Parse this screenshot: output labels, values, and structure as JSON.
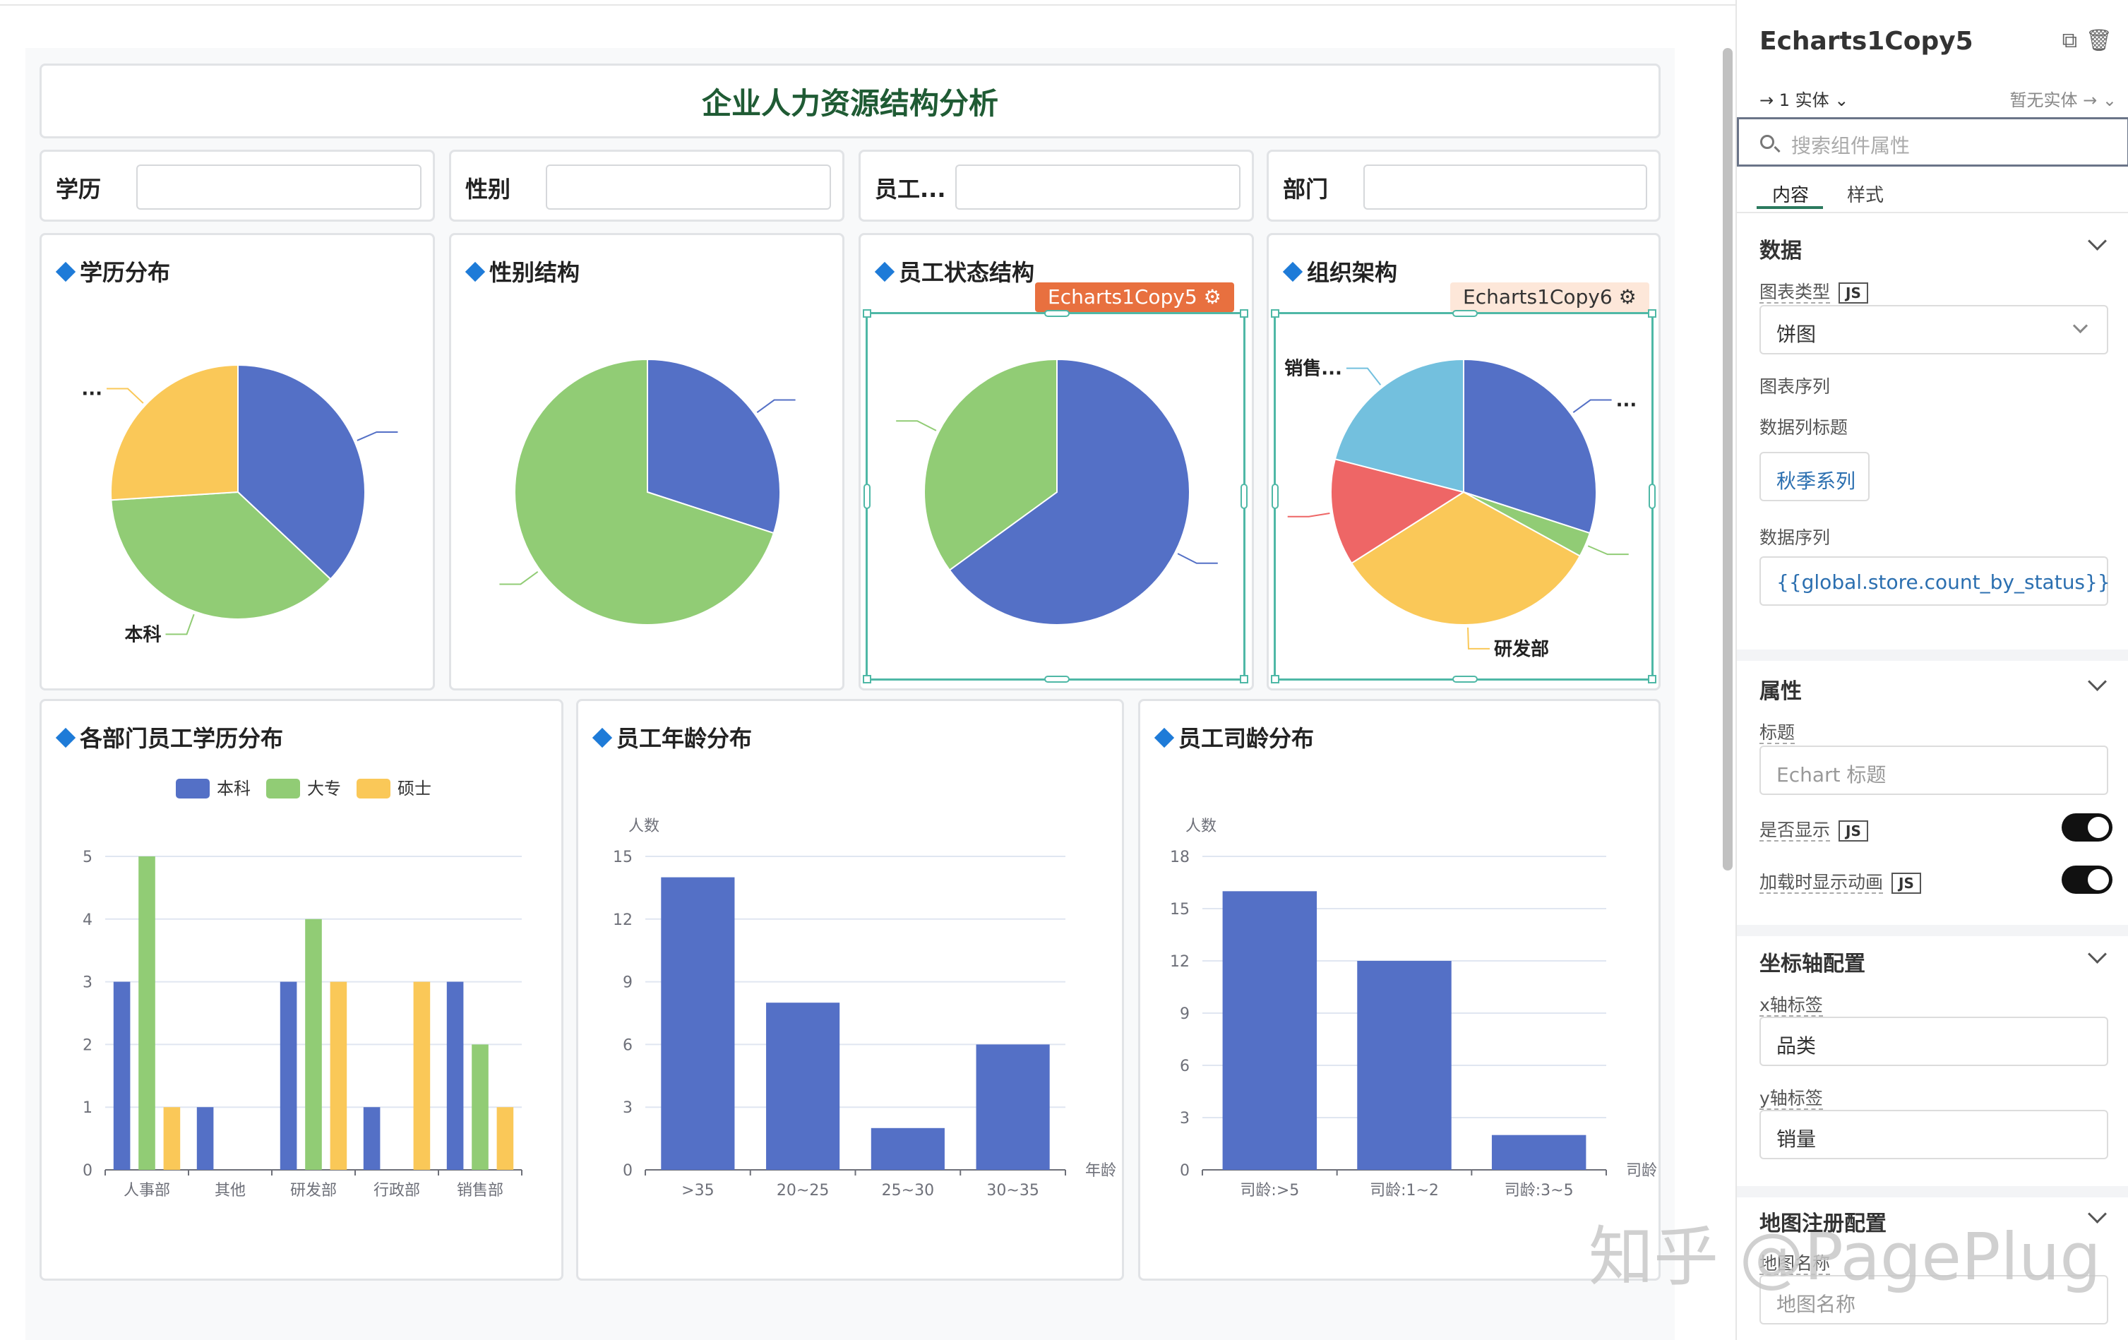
{
  "dashboard": {
    "title": "企业人力资源结构分析",
    "filters": [
      {
        "label": "学历",
        "value": ""
      },
      {
        "label": "性别",
        "value": ""
      },
      {
        "label": "员工...",
        "value": ""
      },
      {
        "label": "部门",
        "value": ""
      }
    ],
    "cards": {
      "edu": "学历分布",
      "gender": "性别结构",
      "status": "员工状态结构",
      "org": "组织架构",
      "dept_edu": "各部门员工学历分布",
      "age": "员工年龄分布",
      "tenure": "员工司龄分布"
    },
    "badges": {
      "status": "Echarts1Copy5",
      "org": "Echarts1Copy6"
    }
  },
  "chart_data": [
    {
      "type": "pie",
      "title": "学历分布",
      "slices": [
        {
          "name": "",
          "value": 37,
          "color": "#5470c6"
        },
        {
          "name": "本科",
          "value": 37,
          "color": "#91cc75"
        },
        {
          "name": "...",
          "value": 26,
          "color": "#fac858"
        }
      ],
      "visible_labels": [
        "...",
        "本科"
      ]
    },
    {
      "type": "pie",
      "title": "性别结构",
      "slices": [
        {
          "name": "",
          "value": 30,
          "color": "#5470c6"
        },
        {
          "name": "",
          "value": 70,
          "color": "#91cc75"
        }
      ]
    },
    {
      "type": "pie",
      "title": "员工状态结构",
      "slices": [
        {
          "name": "",
          "value": 65,
          "color": "#5470c6"
        },
        {
          "name": "",
          "value": 35,
          "color": "#91cc75"
        }
      ]
    },
    {
      "type": "pie",
      "title": "组织架构",
      "slices": [
        {
          "name": "...",
          "value": 30,
          "color": "#5470c6"
        },
        {
          "name": "",
          "value": 3,
          "color": "#91cc75"
        },
        {
          "name": "研发部",
          "value": 33,
          "color": "#fac858"
        },
        {
          "name": "",
          "value": 13,
          "color": "#ee6666"
        },
        {
          "name": "销售...",
          "value": 21,
          "color": "#73c0de"
        }
      ],
      "visible_labels": [
        "...",
        "研发部",
        "销售..."
      ]
    },
    {
      "type": "bar",
      "title": "各部门员工学历分布",
      "categories": [
        "人事部",
        "其他",
        "研发部",
        "行政部",
        "销售部"
      ],
      "series": [
        {
          "name": "本科",
          "values": [
            3,
            1,
            3,
            1,
            3
          ],
          "color": "#5470c6"
        },
        {
          "name": "大专",
          "values": [
            5,
            0,
            4,
            0,
            2
          ],
          "color": "#91cc75"
        },
        {
          "name": "硕士",
          "values": [
            1,
            0,
            3,
            3,
            1
          ],
          "color": "#fac858"
        }
      ],
      "ylim": [
        0,
        5
      ],
      "yticks": [
        0,
        1,
        2,
        3,
        4,
        5
      ],
      "legend": "top-center",
      "grid": true
    },
    {
      "type": "bar",
      "title": "员工年龄分布",
      "categories": [
        ">35",
        "20~25",
        "25~30",
        "30~35"
      ],
      "values": [
        14,
        8,
        2,
        6
      ],
      "color": "#5470c6",
      "ylabel": "人数",
      "xlabel": "年龄",
      "ylim": [
        0,
        15
      ],
      "yticks": [
        0,
        3,
        6,
        9,
        12,
        15
      ],
      "grid": true
    },
    {
      "type": "bar",
      "title": "员工司龄分布",
      "categories": [
        "司龄:>5",
        "司龄:1~2",
        "司龄:3~5"
      ],
      "values": [
        16,
        12,
        2
      ],
      "color": "#5470c6",
      "ylabel": "人数",
      "xlabel": "司龄",
      "ylim": [
        0,
        18
      ],
      "yticks": [
        0,
        3,
        6,
        9,
        12,
        15,
        18
      ],
      "grid": true
    }
  ],
  "panel": {
    "title": "Echarts1Copy5",
    "entity_left": "→ 1 实体 ⌄",
    "entity_right": "暂无实体 → ⌄",
    "search_placeholder": "搜索组件属性",
    "tabs": [
      "内容",
      "样式"
    ],
    "sections": {
      "data": "数据",
      "props": "属性",
      "axis": "坐标轴配置",
      "map": "地图注册配置"
    },
    "chart_type_label": "图表类型",
    "chart_type_value": "饼图",
    "series_label": "图表序列",
    "series_title_label": "数据列标题",
    "series_title_value": "秋季系列",
    "data_series_label": "数据序列",
    "data_series_value": "{{global.store.count_by_status}}",
    "title_label": "标题",
    "title_placeholder": "Echart 标题",
    "show_label": "是否显示",
    "anim_label": "加载时显示动画",
    "x_label": "x轴标签",
    "x_value": "品类",
    "y_label": "y轴标签",
    "y_value": "销量",
    "map_name_label": "地图名称",
    "map_name_placeholder": "地图名称",
    "js": "JS"
  },
  "watermark": "知乎 @PagePlug",
  "colors": {
    "accent": "#2b7a5e",
    "selection": "#4fb8a6",
    "badge_active": "#e8703f",
    "badge_inactive": "#fde7d9"
  }
}
